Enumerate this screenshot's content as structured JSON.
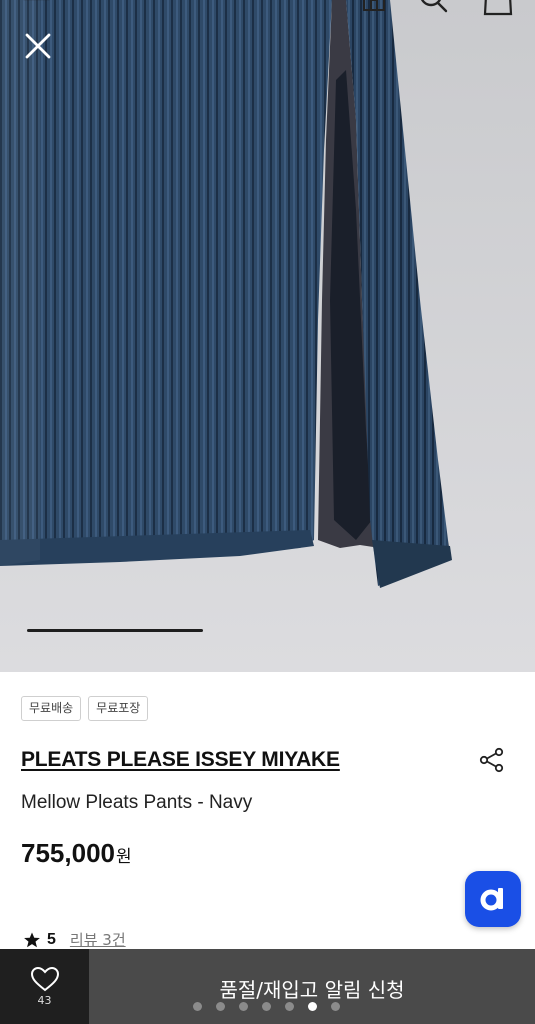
{
  "badges": [
    "무료배송",
    "무료포장"
  ],
  "product": {
    "brand": "PLEATS PLEASE ISSEY MIYAKE",
    "name": "Mellow Pleats Pants - Navy",
    "price": "755,000",
    "price_unit": "원"
  },
  "rating": {
    "value": "5",
    "review_link": "리뷰 3건"
  },
  "bottom_bar": {
    "like_count": "43",
    "restock_label": "품절/재입고 알림 신청"
  },
  "carousel": {
    "total_dots": 7,
    "active_index": 5
  },
  "colors": {
    "fab_blue": "#1a4fe6",
    "fabric_navy": "#2d4563",
    "bottom_dark": "#1f1f1f",
    "bottom_gray": "#4a4a4a"
  },
  "icons": {
    "close": "close-icon",
    "back": "arrow-left-icon",
    "home": "home-icon",
    "search": "search-icon",
    "cart": "shopping-bag-icon",
    "share": "share-icon",
    "heart": "heart-icon",
    "star": "star-icon",
    "fab": "d-logo-icon"
  }
}
